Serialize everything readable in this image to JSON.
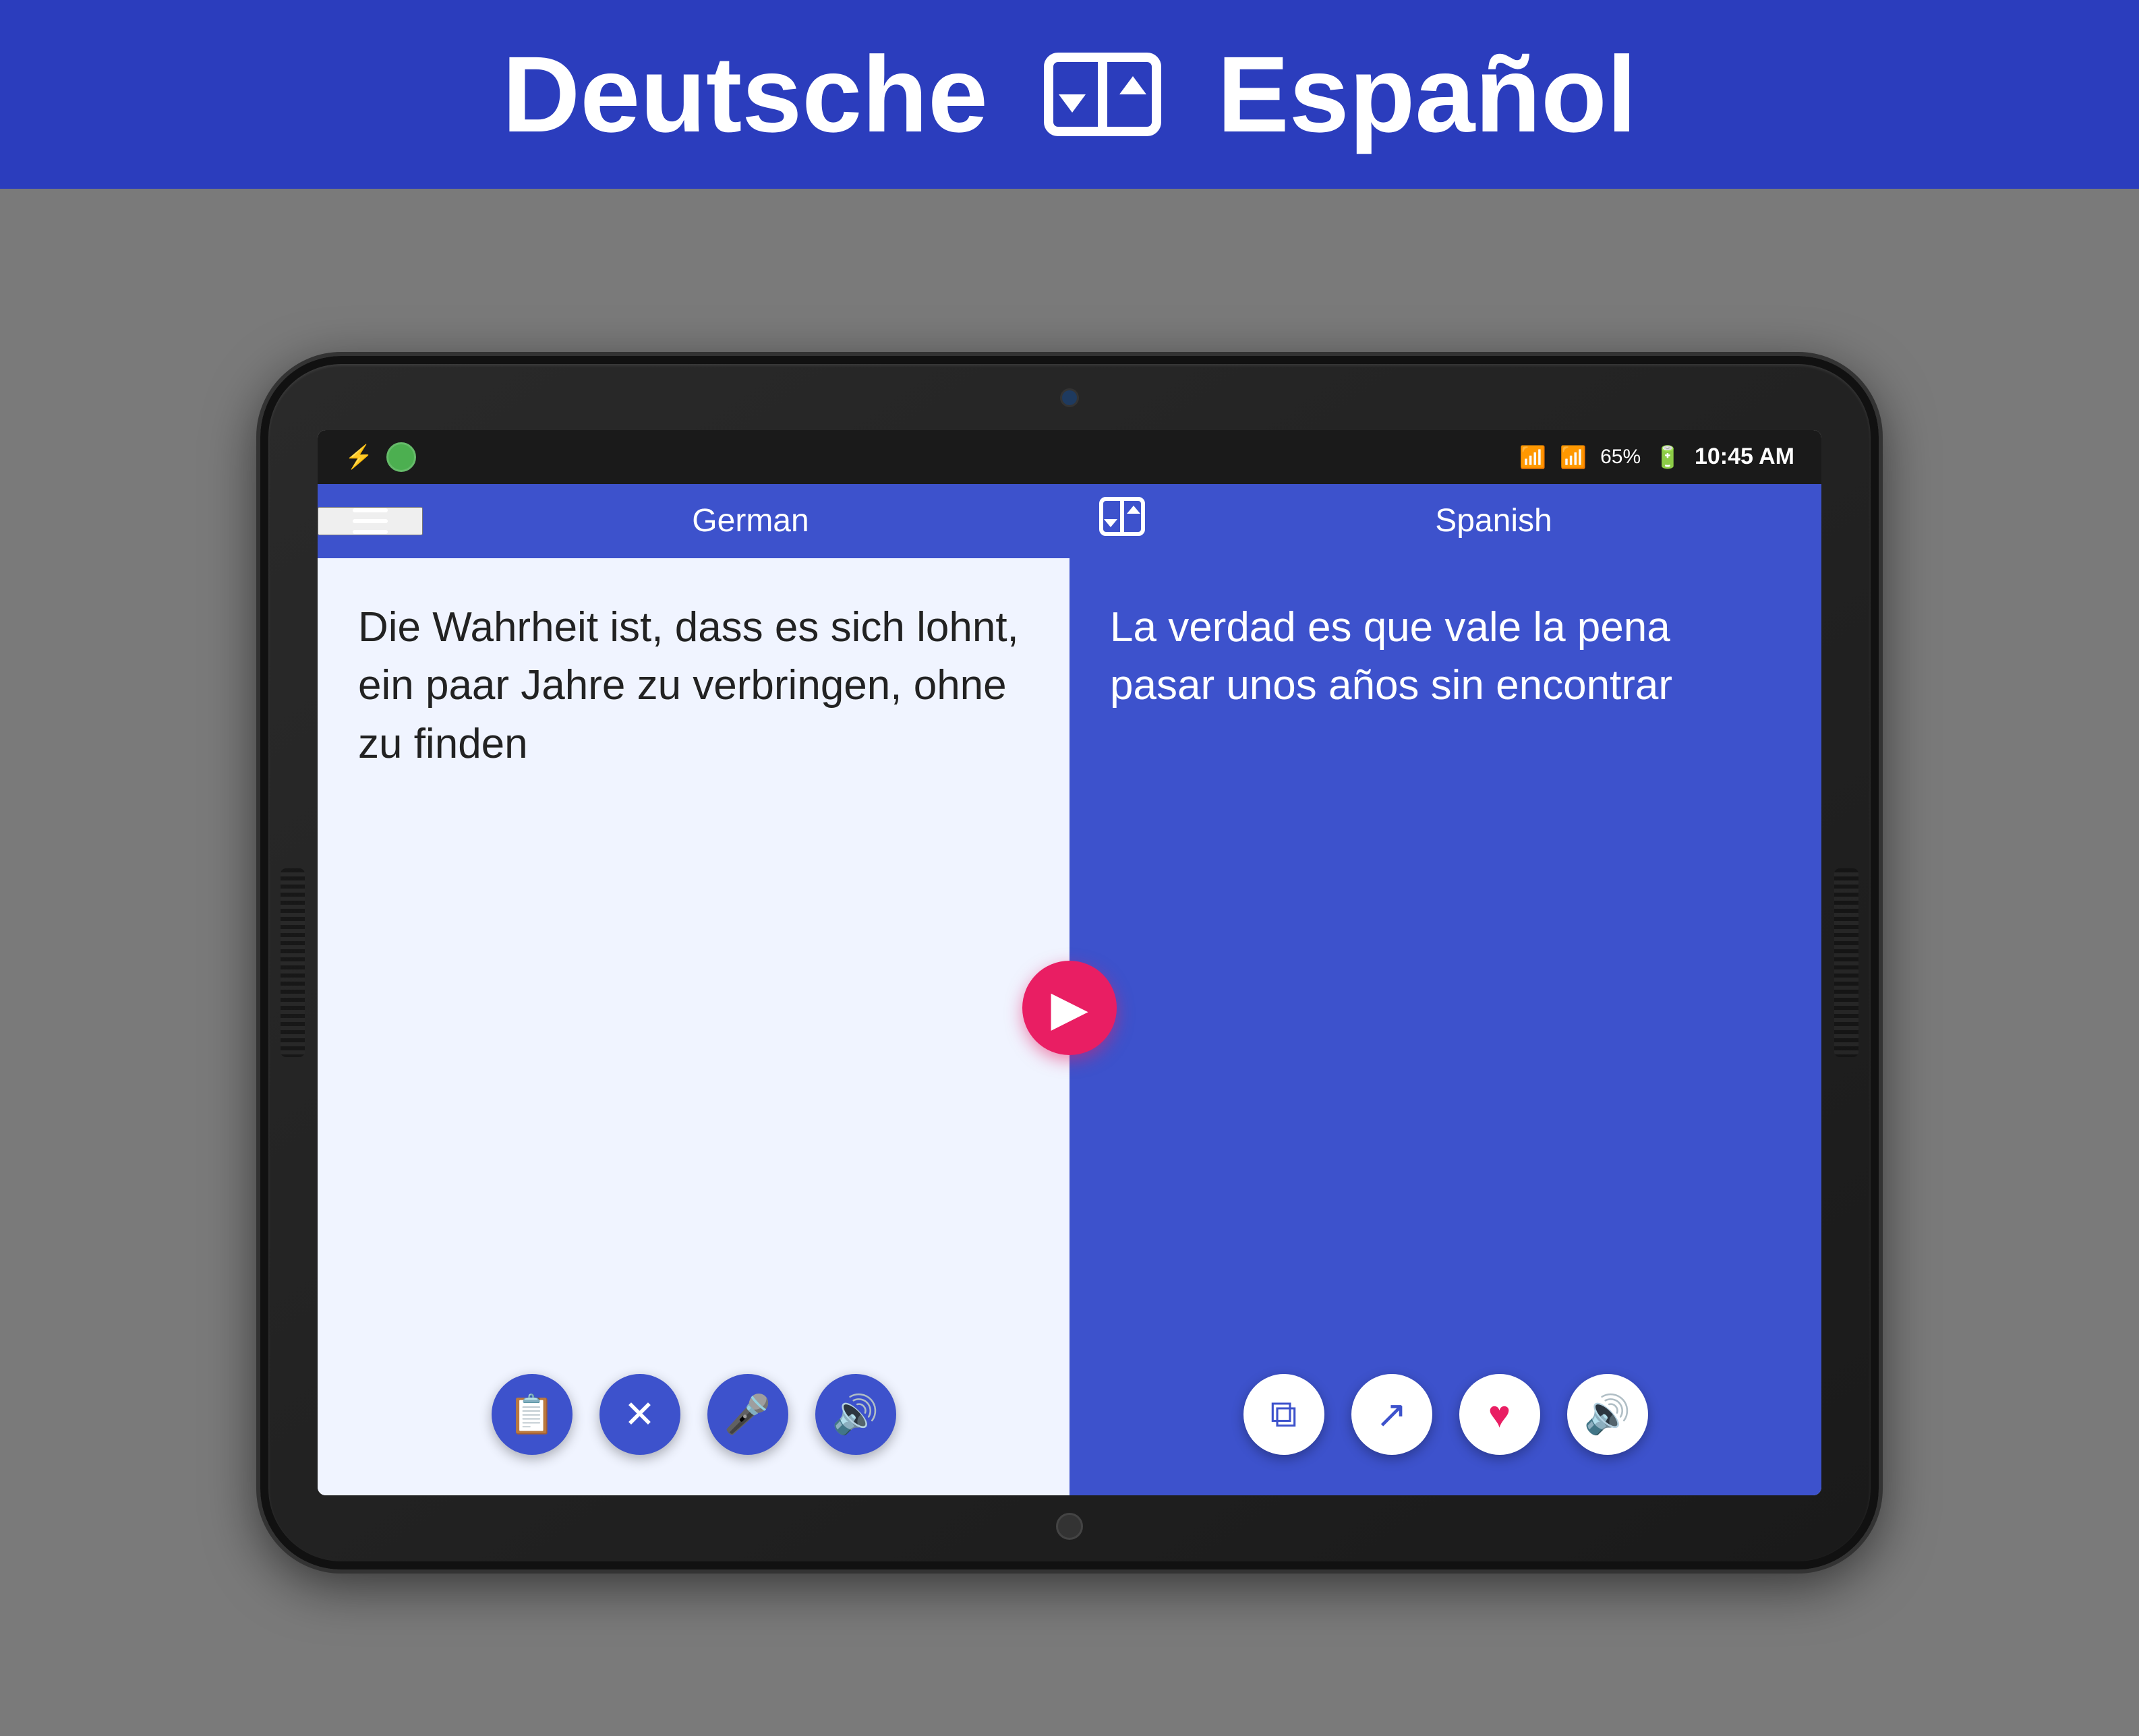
{
  "header": {
    "lang_left": "Deutsche",
    "lang_right": "Español"
  },
  "status_bar": {
    "battery": "65%",
    "time": "10:45 AM"
  },
  "toolbar": {
    "german_label": "German",
    "spanish_label": "Spanish"
  },
  "german_panel": {
    "text": "Die Wahrheit ist, dass es sich lohnt, ein paar Jahre zu verbringen, ohne zu finden",
    "actions": {
      "clipboard_label": "clipboard",
      "clear_label": "clear",
      "mic_label": "microphone",
      "speak_label": "speaker"
    }
  },
  "spanish_panel": {
    "text": "La verdad es que vale la pena pasar unos años sin encontrar",
    "actions": {
      "copy_label": "copy",
      "share_label": "share",
      "heart_label": "favorite",
      "speak_label": "speaker"
    }
  },
  "fab": {
    "label": "translate"
  }
}
